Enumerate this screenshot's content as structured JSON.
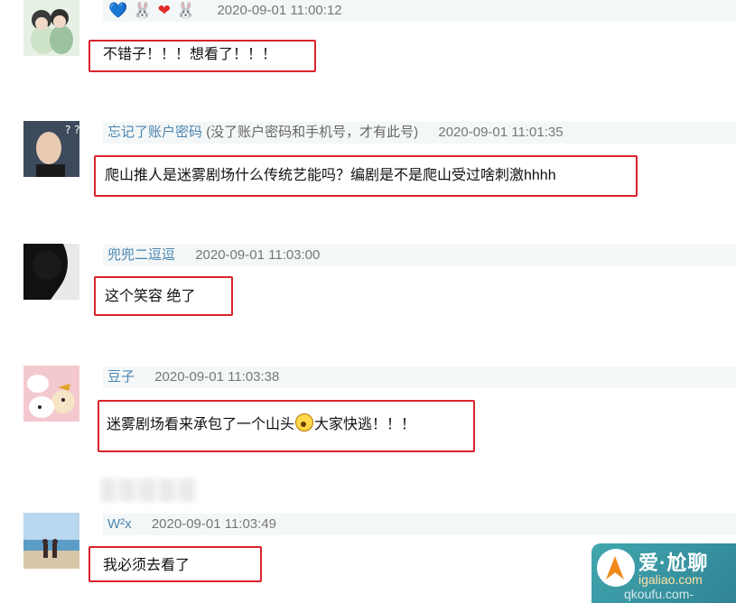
{
  "comments": [
    {
      "id": "c1",
      "badge_icons": [
        "heart-icon",
        "rabbit-icon",
        "heart-icon",
        "rabbit-icon"
      ],
      "badges": [
        "💙",
        "🐰",
        "❤",
        "🐰"
      ],
      "time": "2020-09-01 11:00:12",
      "text": "不错子！！！想看了！！！"
    },
    {
      "id": "c2",
      "user": "忘记了账户密码",
      "user_note": "(没了账户密码和手机号，才有此号)",
      "time": "2020-09-01 11:01:35",
      "text": "爬山推人是迷雾剧场什么传统艺能吗？编剧是不是爬山受过啥刺激hhhh"
    },
    {
      "id": "c3",
      "user": "兜兜二逗逗",
      "time": "2020-09-01 11:03:00",
      "text": "这个笑容 绝了"
    },
    {
      "id": "c4",
      "user": "豆子",
      "time": "2020-09-01 11:03:38",
      "text_before_emoji": "迷雾剧场看来承包了一个山头",
      "emoji": "shocked-face-emoji",
      "text_after_emoji": "大家快逃！！！"
    },
    {
      "id": "c5",
      "user": "W²x",
      "time": "2020-09-01 11:03:49",
      "text": "我必须去看了"
    }
  ],
  "watermark": {
    "title": "爱·尬聊",
    "site": "igaliao.com",
    "site2": "qkoufu.com-"
  },
  "colors": {
    "highlight_border": "#d9232c",
    "username": "#4b86b0",
    "meta_bar": "#f4f7f7"
  }
}
